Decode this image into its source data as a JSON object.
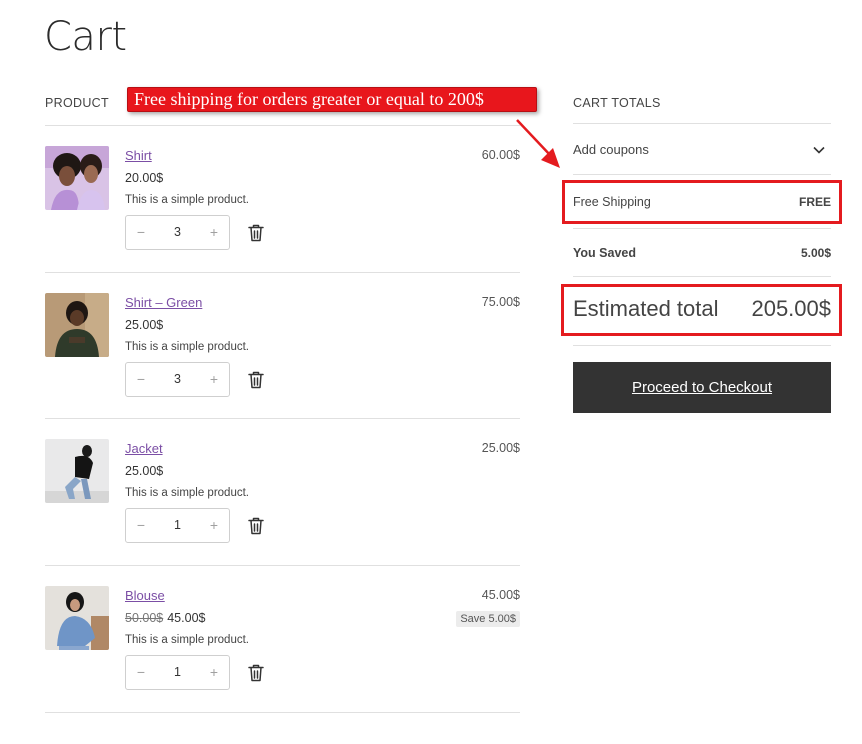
{
  "page": {
    "title": "Cart"
  },
  "table": {
    "product_header": "PRODUCT",
    "totals_header": "CART TOTALS"
  },
  "banner": {
    "text": "Free shipping for orders greater or equal to 200$"
  },
  "items": [
    {
      "name": "Shirt",
      "unit_price": "20.00$",
      "old_price": "",
      "description": "This is a simple product.",
      "quantity": "3",
      "line_total": "60.00$",
      "save_badge": "",
      "image": "two-women-photo"
    },
    {
      "name": "Shirt – Green",
      "unit_price": "25.00$",
      "old_price": "",
      "description": "This is a simple product.",
      "quantity": "3",
      "line_total": "75.00$",
      "save_badge": "",
      "image": "man-portrait-photo"
    },
    {
      "name": "Jacket",
      "unit_price": "25.00$",
      "old_price": "",
      "description": "This is a simple product.",
      "quantity": "1",
      "line_total": "25.00$",
      "save_badge": "",
      "image": "woman-jacket-photo"
    },
    {
      "name": "Blouse",
      "unit_price": "45.00$",
      "old_price": "50.00$",
      "description": "This is a simple product.",
      "quantity": "1",
      "line_total": "45.00$",
      "save_badge": "Save 5.00$",
      "image": "woman-blouse-photo"
    }
  ],
  "qty_controls": {
    "minus": "−",
    "plus": "+"
  },
  "totals": {
    "coupons_label": "Add coupons",
    "shipping_label": "Free Shipping",
    "shipping_value": "FREE",
    "saved_label": "You Saved",
    "saved_value": "5.00$",
    "estimated_label": "Estimated total",
    "estimated_value": "205.00$",
    "checkout_label": "Proceed to Checkout"
  },
  "colors": {
    "link": "#7b4ea5",
    "highlight": "#e41b1f",
    "checkout_bg": "#333333",
    "banner_bg": "#e8161c"
  }
}
